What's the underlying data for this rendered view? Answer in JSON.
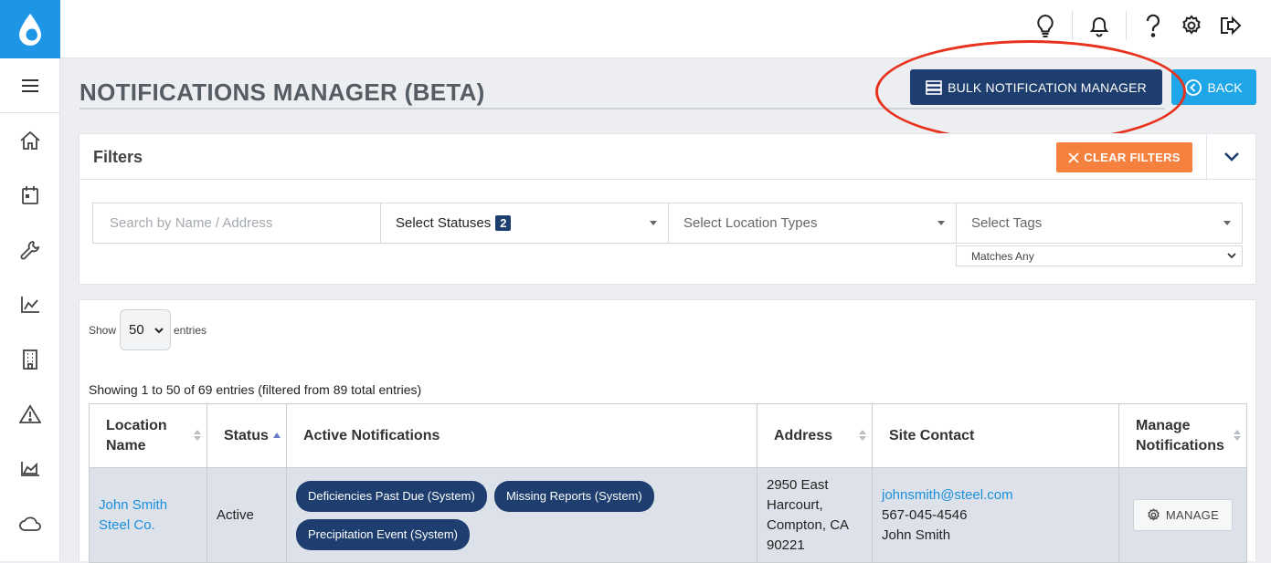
{
  "header": {
    "icons": [
      "lightbulb-icon",
      "bell-icon",
      "help-icon",
      "gear-icon",
      "logout-icon"
    ]
  },
  "sidebar": {
    "icons": [
      "menu-icon",
      "home-icon",
      "calendar-icon",
      "wrench-icon",
      "chart-icon",
      "building-icon",
      "warning-icon",
      "area-chart-icon",
      "cloud-icon"
    ]
  },
  "page": {
    "title": "NOTIFICATIONS MANAGER (BETA)",
    "bulk_button_label": "BULK NOTIFICATION MANAGER",
    "back_button_label": "BACK",
    "annotation_color": "#e8321e"
  },
  "filters": {
    "title": "Filters",
    "clear_label": "CLEAR FILTERS",
    "search_placeholder": "Search by Name / Address",
    "statuses_label": "Select Statuses",
    "statuses_count": "2",
    "location_types_label": "Select Location Types",
    "tags_label": "Select Tags",
    "tags_match": "Matches Any"
  },
  "table": {
    "show_label": "Show",
    "entries_value": "50",
    "entries_label": "entries",
    "info": "Showing 1 to 50 of 69 entries (filtered from 89 total entries)",
    "columns": {
      "location_line1": "Location",
      "location_line2": "Name",
      "status": "Status",
      "active_notifications": "Active Notifications",
      "address": "Address",
      "site_contact": "Site Contact",
      "manage_line1": "Manage",
      "manage_line2": "Notifications"
    },
    "rows": [
      {
        "location_line1": "John Smith",
        "location_line2": "Steel Co.",
        "status": "Active",
        "notifications": [
          "Deficiencies Past Due (System)",
          "Missing Reports (System)",
          "Precipitation Event (System)"
        ],
        "address_line1": "2950 East",
        "address_line2": "Harcourt,",
        "address_line3": "Compton, CA",
        "address_line4": "90221",
        "contact_email": "johnsmith@steel.com",
        "contact_phone": "567-045-4546",
        "contact_name": "John Smith",
        "manage_label": "MANAGE"
      }
    ]
  },
  "colors": {
    "brand_blue": "#1f95e6",
    "navy": "#1d3e6e",
    "back_blue": "#1ea6e9",
    "orange": "#f5813e",
    "link": "#1a8fdc"
  }
}
